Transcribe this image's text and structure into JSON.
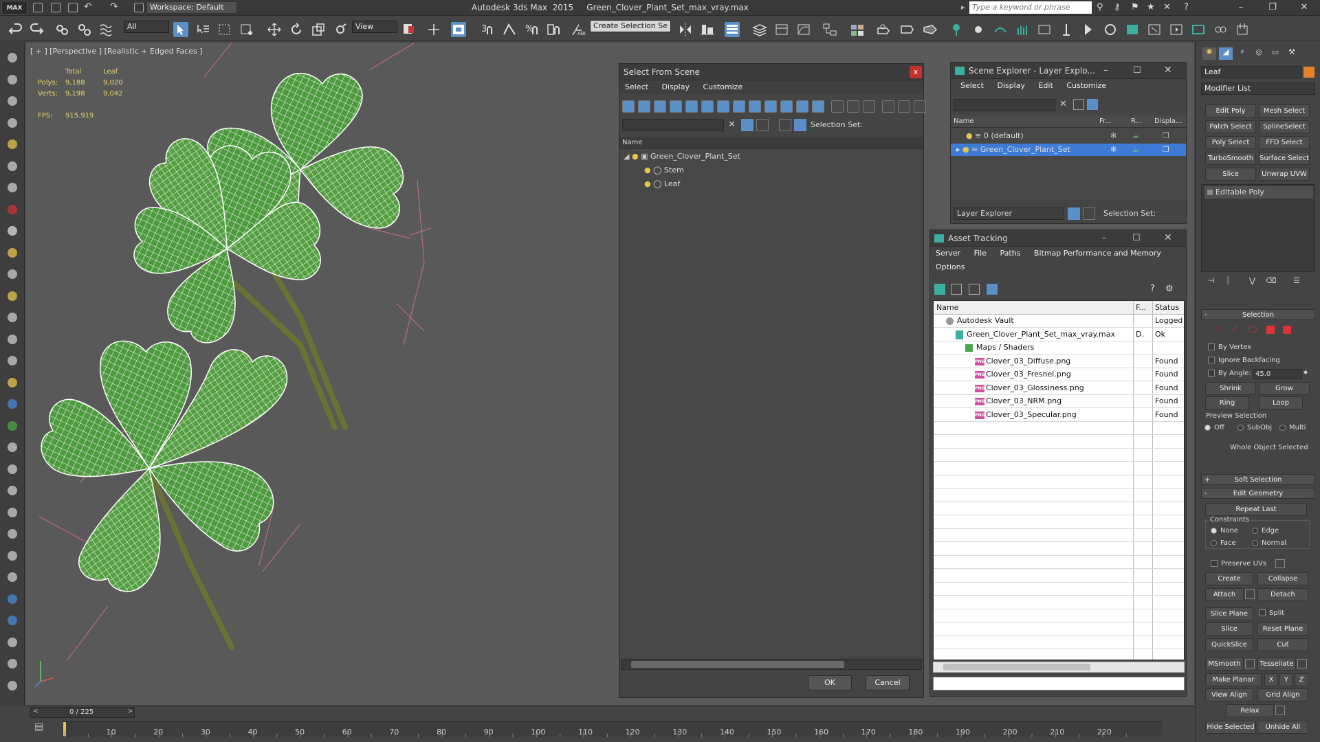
{
  "app": {
    "title_left": "Autodesk 3ds Max  2015",
    "title_file": "Green_Clover_Plant_Set_max_vray.max",
    "logo": "MAX",
    "workspace": "Workspace: Default",
    "search_placeholder": "Type a keyword or phrase"
  },
  "toolbar": {
    "filter_value": "All",
    "view_value": "View",
    "selection_set_value": "Create Selection Se",
    "snap_3": "3",
    "percent": "%"
  },
  "viewport": {
    "label": "[ + ] [Perspective ] [Realistic + Edged Faces ]",
    "stats": {
      "col_total": "Total",
      "col_leaf": "Leaf",
      "polys_label": "Polys:",
      "polys_total": "9,188",
      "polys_leaf": "9,020",
      "verts_label": "Verts:",
      "verts_total": "9,198",
      "verts_leaf": "9,042",
      "fps_label": "FPS:",
      "fps_value": "915.919"
    }
  },
  "select_from_scene": {
    "title": "Select From Scene",
    "menu": [
      "Select",
      "Display",
      "Customize"
    ],
    "selection_set_label": "Selection Set:",
    "col_name": "Name",
    "tree": [
      {
        "label": "Green_Clover_Plant_Set",
        "level": 0
      },
      {
        "label": "Stem",
        "level": 1
      },
      {
        "label": "Leaf",
        "level": 1
      }
    ],
    "ok": "OK",
    "cancel": "Cancel"
  },
  "scene_explorer": {
    "title": "Scene Explorer - Layer Explo...",
    "menu": [
      "Select",
      "Display",
      "Edit",
      "Customize"
    ],
    "cols": [
      "Name",
      "Fr...",
      "R...",
      "Displa..."
    ],
    "rows": [
      {
        "label": "0 (default)",
        "selected": false
      },
      {
        "label": "Green_Clover_Plant_Set",
        "selected": true
      }
    ],
    "footer_dropdown": "Layer Explorer",
    "selection_set_label": "Selection Set:"
  },
  "asset_tracking": {
    "title": "Asset Tracking",
    "menu": [
      "Server",
      "File",
      "Paths",
      "Bitmap Performance and Memory"
    ],
    "menu2": [
      "Options"
    ],
    "cols": [
      "Name",
      "F...",
      "Status"
    ],
    "rows": [
      {
        "name": "Autodesk Vault",
        "f": "",
        "status": "Logged",
        "indent": 1,
        "icon": "vault-icon"
      },
      {
        "name": "Green_Clover_Plant_Set_max_vray.max",
        "f": "D.",
        "status": "Ok",
        "indent": 2,
        "icon": "max-file-icon"
      },
      {
        "name": "Maps / Shaders",
        "f": "",
        "status": "",
        "indent": 3,
        "icon": "maps-folder-icon"
      },
      {
        "name": "Clover_03_Diffuse.png",
        "f": "",
        "status": "Found",
        "indent": 4,
        "icon": "png-file-icon"
      },
      {
        "name": "Clover_03_Fresnel.png",
        "f": "",
        "status": "Found",
        "indent": 4,
        "icon": "png-file-icon"
      },
      {
        "name": "Clover_03_Glossiness.png",
        "f": "",
        "status": "Found",
        "indent": 4,
        "icon": "png-file-icon"
      },
      {
        "name": "Clover_03_NRM.png",
        "f": "",
        "status": "Found",
        "indent": 4,
        "icon": "png-file-icon"
      },
      {
        "name": "Clover_03_Specular.png",
        "f": "",
        "status": "Found",
        "indent": 4,
        "icon": "png-file-icon"
      }
    ],
    "png_badge": "PNG"
  },
  "command_panel": {
    "object_name": "Leaf",
    "modifier_list": "Modifier List",
    "modifier_buttons": [
      "Edit Poly",
      "Mesh Select",
      "Patch Select",
      "SplineSelect",
      "Poly Select",
      "FFD Select",
      "TurboSmooth",
      "Surface Select",
      "Slice",
      "Unwrap UVW"
    ],
    "stack_item": "Editable Poly",
    "selection": {
      "header": "Selection",
      "by_vertex": "By Vertex",
      "ignore_backfacing": "Ignore Backfacing",
      "by_angle": "By Angle:",
      "angle_value": "45.0",
      "shrink": "Shrink",
      "grow": "Grow",
      "ring": "Ring",
      "loop": "Loop",
      "preview_label": "Preview Selection",
      "preview_off": "Off",
      "preview_subobj": "SubObj",
      "preview_multi": "Multi",
      "whole_object": "Whole Object Selected"
    },
    "soft_selection": "Soft Selection",
    "edit_geometry": {
      "header": "Edit Geometry",
      "repeat_last": "Repeat Last",
      "constraints": "Constraints",
      "none": "None",
      "edge": "Edge",
      "face": "Face",
      "normal": "Normal",
      "preserve_uvs": "Preserve UVs",
      "create": "Create",
      "collapse": "Collapse",
      "attach": "Attach",
      "detach": "Detach",
      "slice_plane": "Slice Plane",
      "split": "Split",
      "slice": "Slice",
      "reset_plane": "Reset Plane",
      "quickslice": "QuickSlice",
      "cut": "Cut",
      "msmooth": "MSmooth",
      "tessellate": "Tessellate",
      "make_planar": "Make Planar",
      "x": "X",
      "y": "Y",
      "z": "Z",
      "view_align": "View Align",
      "grid_align": "Grid Align",
      "relax": "Relax",
      "hide_selected": "Hide Selected",
      "unhide_all": "Unhide All"
    }
  },
  "timeline": {
    "frame_counter": "0 / 225",
    "ticks": [
      "10",
      "20",
      "30",
      "40",
      "50",
      "60",
      "70",
      "80",
      "90",
      "100",
      "110",
      "120",
      "130",
      "140",
      "150",
      "160",
      "170",
      "180",
      "190",
      "200",
      "210",
      "220"
    ]
  },
  "colors": {
    "accent_blue": "#5b8fc7",
    "selected_row": "#3e7bd6",
    "wireframe_fill": "#4e9a3e",
    "stem": "#5e6a2e",
    "close_red": "#c4302b",
    "stats_yellow": "#e8d66a"
  }
}
